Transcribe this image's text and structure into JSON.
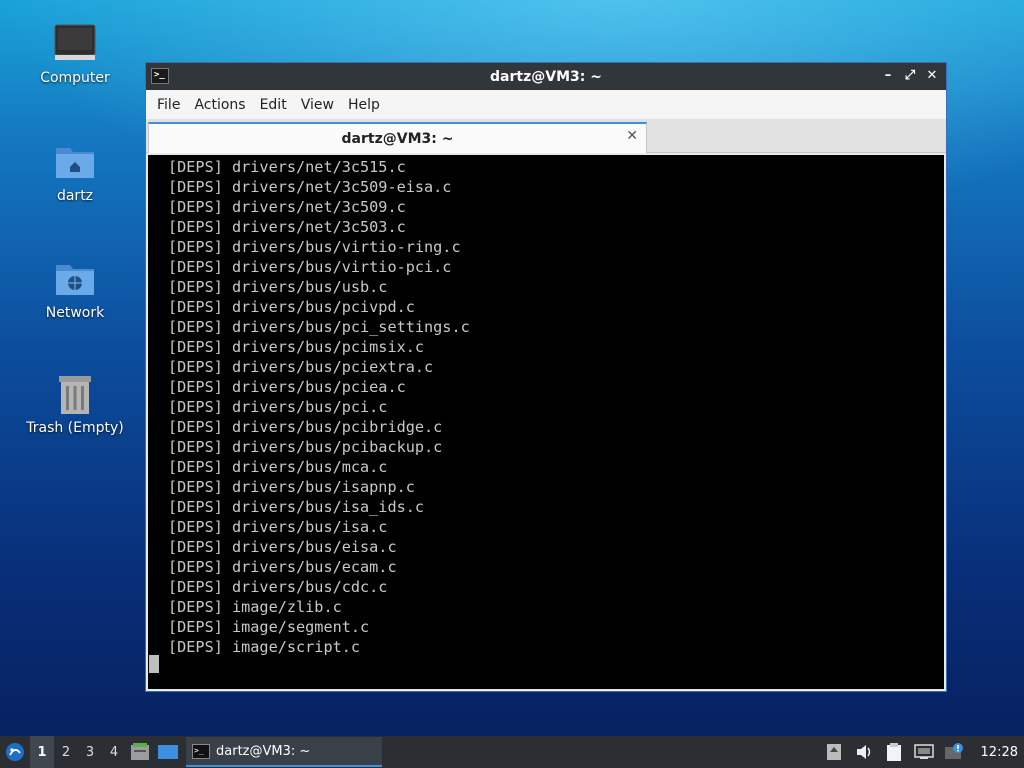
{
  "desktop": {
    "icons": [
      {
        "label": "Computer",
        "icon": "monitor-icon"
      },
      {
        "label": "dartz",
        "icon": "home-folder-icon"
      },
      {
        "label": "Network",
        "icon": "network-folder-icon"
      },
      {
        "label": "Trash (Empty)",
        "icon": "trash-icon"
      }
    ]
  },
  "window": {
    "title": "dartz@VM3: ~",
    "controls": {
      "minimize": "–",
      "maximize": "⤢",
      "close": "✕"
    },
    "menu": [
      "File",
      "Actions",
      "Edit",
      "View",
      "Help"
    ],
    "tab": {
      "label": "dartz@VM3: ~",
      "close": "✕"
    },
    "terminal_lines": [
      "[DEPS] drivers/net/3c515.c",
      "[DEPS] drivers/net/3c509-eisa.c",
      "[DEPS] drivers/net/3c509.c",
      "[DEPS] drivers/net/3c503.c",
      "[DEPS] drivers/bus/virtio-ring.c",
      "[DEPS] drivers/bus/virtio-pci.c",
      "[DEPS] drivers/bus/usb.c",
      "[DEPS] drivers/bus/pcivpd.c",
      "[DEPS] drivers/bus/pci_settings.c",
      "[DEPS] drivers/bus/pcimsix.c",
      "[DEPS] drivers/bus/pciextra.c",
      "[DEPS] drivers/bus/pciea.c",
      "[DEPS] drivers/bus/pci.c",
      "[DEPS] drivers/bus/pcibridge.c",
      "[DEPS] drivers/bus/pcibackup.c",
      "[DEPS] drivers/bus/mca.c",
      "[DEPS] drivers/bus/isapnp.c",
      "[DEPS] drivers/bus/isa_ids.c",
      "[DEPS] drivers/bus/isa.c",
      "[DEPS] drivers/bus/eisa.c",
      "[DEPS] drivers/bus/ecam.c",
      "[DEPS] drivers/bus/cdc.c",
      "[DEPS] image/zlib.c",
      "[DEPS] image/segment.c",
      "[DEPS] image/script.c"
    ]
  },
  "taskbar": {
    "workspaces": [
      "1",
      "2",
      "3",
      "4"
    ],
    "active_workspace": "1",
    "task_label": "dartz@VM3: ~",
    "clock": "12:28"
  }
}
